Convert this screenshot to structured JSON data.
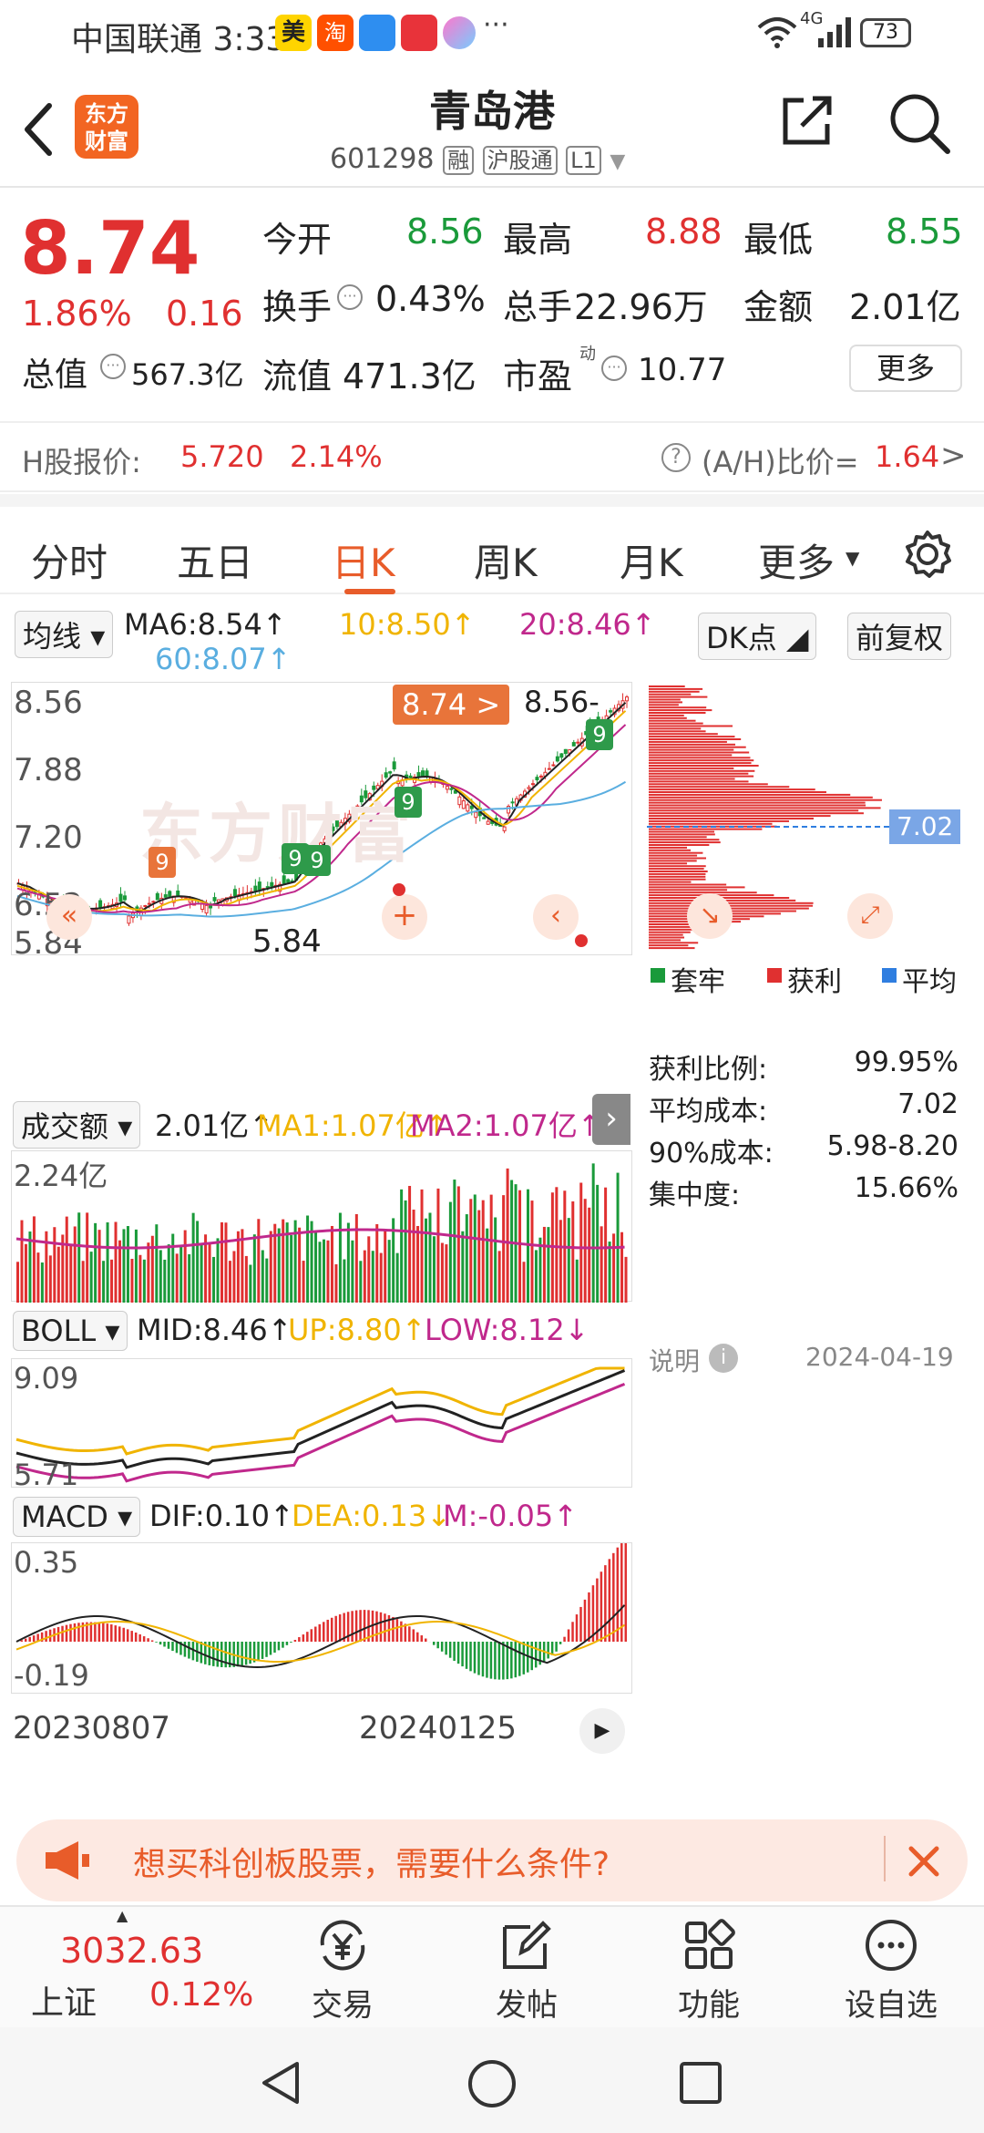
{
  "status": {
    "carrier_time": "中国联通 3:33",
    "network": "4G",
    "battery": "73",
    "app_icons": [
      "美",
      "淘",
      "cloud-icon",
      "huawei-icon",
      "shell-icon"
    ],
    "more": "···"
  },
  "nav": {
    "logo": "东方\n财富",
    "title": "青岛港",
    "code": "601298",
    "tags": [
      "融",
      "沪股通",
      "L1"
    ]
  },
  "quote": {
    "price": "8.74",
    "change_pct": "1.86%",
    "change_amt": "0.16",
    "stats": [
      {
        "label": "今开",
        "value": "8.56",
        "color": "green"
      },
      {
        "label": "最高",
        "value": "8.88",
        "color": "red"
      },
      {
        "label": "最低",
        "value": "8.55",
        "color": "green"
      },
      {
        "label": "换手",
        "value": "0.43%",
        "color": "black"
      },
      {
        "label": "总手",
        "value": "22.96万",
        "color": "black"
      },
      {
        "label": "金额",
        "value": "2.01亿",
        "color": "black"
      }
    ],
    "total_value_label": "总值",
    "total_value": "567.3亿",
    "float_value_label": "流值",
    "float_value": "471.3亿",
    "pe_label": "市盈",
    "pe_sup": "动",
    "pe_value": "10.77",
    "more_button": "更多"
  },
  "hshare": {
    "label": "H股报价:",
    "price": "5.720",
    "pct": "2.14%",
    "ratio_label": "(A/H)比价=",
    "ratio": "1.64",
    "arrow": ">"
  },
  "tabs": [
    {
      "label": "分时"
    },
    {
      "label": "五日"
    },
    {
      "label": "日K"
    },
    {
      "label": "周K"
    },
    {
      "label": "月K"
    },
    {
      "label": "更多"
    }
  ],
  "ma": {
    "selector": "均线",
    "ma6": "MA6:8.54↑",
    "ma10": "10:8.50↑",
    "ma20": "20:8.46↑",
    "ma60": "60:8.07↑",
    "dk_button": "DK点",
    "adjust_button": "前复权"
  },
  "kline": {
    "y_labels": [
      "8.56",
      "7.88",
      "7.20",
      "6.52",
      "5.84"
    ],
    "price_tag": "8.74 >",
    "last_tag": "8.56-",
    "low_label": "5.84",
    "watermark": "东方财富",
    "markers": [
      "9",
      "9",
      "9",
      "9",
      "9"
    ]
  },
  "chip": {
    "avg_tag": "7.02",
    "legend": [
      {
        "label": "套牢",
        "color": "#1a9a3a"
      },
      {
        "label": "获利",
        "color": "#e03030"
      },
      {
        "label": "平均",
        "color": "#2f7ee0"
      }
    ],
    "rows": [
      {
        "label": "获利比例:",
        "value": "99.95%"
      },
      {
        "label": "平均成本:",
        "value": "7.02"
      },
      {
        "label": "90%成本:",
        "value": "5.98-8.20"
      },
      {
        "label": "集中度:",
        "value": "15.66%"
      }
    ],
    "note_label": "说明",
    "date": "2024-04-19"
  },
  "volume": {
    "selector": "成交额",
    "value": "2.01亿↑",
    "ma1": "MA1:1.07亿↑",
    "ma2": "MA2:1.07亿↑",
    "y_label": "2.24亿"
  },
  "boll": {
    "selector": "BOLL",
    "mid": "MID:8.46↑",
    "up": "UP:8.80↑",
    "low": "LOW:8.12↓",
    "y_top": "9.09",
    "y_bottom": "5.71"
  },
  "macd": {
    "selector": "MACD",
    "dif": "DIF:0.10↑",
    "dea": "DEA:0.13↓",
    "m": "M:-0.05↑",
    "y_top": "0.35",
    "y_bottom": "-0.19"
  },
  "xaxis": {
    "start": "20230807",
    "mid": "20240125"
  },
  "ad": {
    "text": "想买科创板股票，需要什么条件?"
  },
  "bottom": {
    "index_value": "3032.63",
    "index_name": "上证",
    "index_pct": "0.12%",
    "items": [
      {
        "label": "交易"
      },
      {
        "label": "发帖"
      },
      {
        "label": "功能"
      },
      {
        "label": "设自选"
      }
    ]
  },
  "colors": {
    "accent": "#e85c2a",
    "up": "#e03030",
    "down": "#1a9a3a",
    "ma10": "#f0b400",
    "ma20": "#c0288c",
    "ma60": "#5aaee0"
  }
}
